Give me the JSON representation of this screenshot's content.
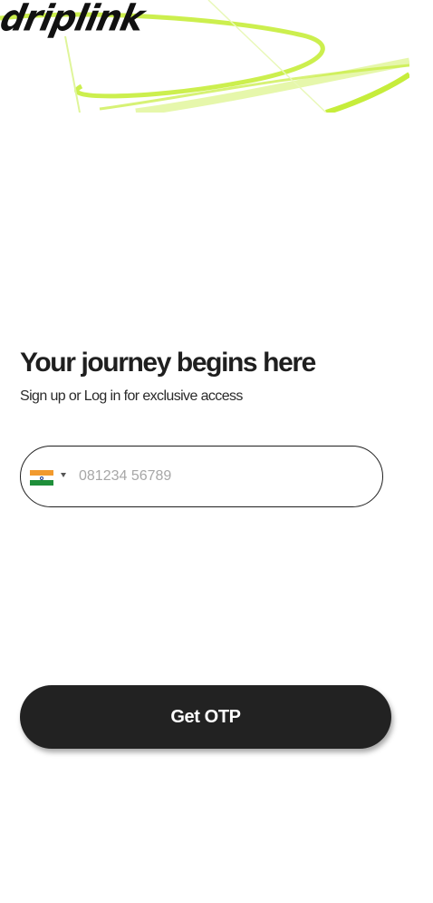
{
  "brand": {
    "logo_text": "driplink",
    "accent_color": "#c6ed3b"
  },
  "login": {
    "heading": "Your journey begins here",
    "subheading": "Sign up or Log in for exclusive access"
  },
  "phone": {
    "country_flag": "india-flag-icon",
    "selected_country": "IN",
    "placeholder": "081234 56789",
    "value": ""
  },
  "actions": {
    "get_otp_label": "Get OTP",
    "button_color": "#222222"
  }
}
